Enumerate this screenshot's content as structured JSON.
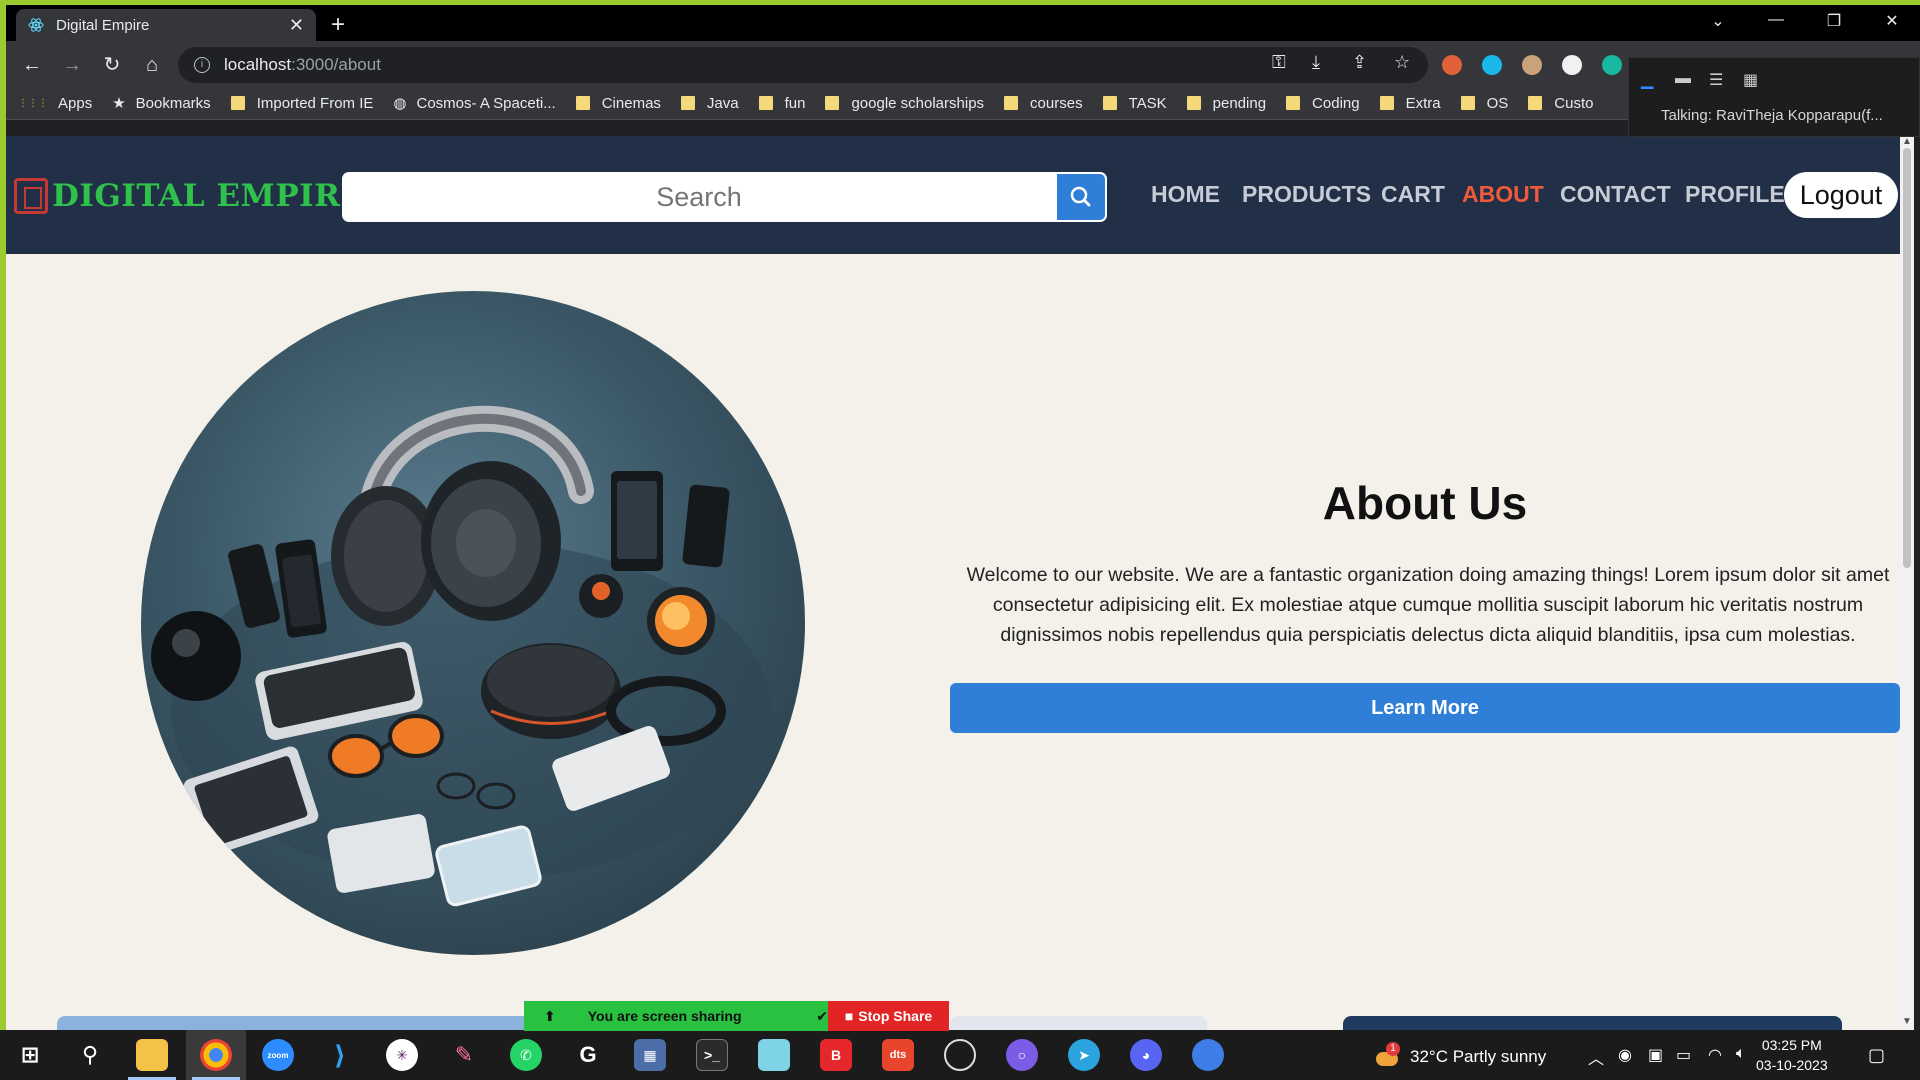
{
  "browser": {
    "tab_title": "Digital Empire",
    "tab_close": "✕",
    "new_tab": "+",
    "url_host": "localhost",
    "url_path": ":3000/about",
    "window_controls": {
      "dropdown": "⌄",
      "minimize": "—",
      "restore": "❐",
      "close": "✕"
    },
    "bookmarks": [
      {
        "label": "Apps",
        "kind": "apps"
      },
      {
        "label": "Bookmarks",
        "kind": "star"
      },
      {
        "label": "Imported From IE",
        "kind": "folder"
      },
      {
        "label": "Cosmos- A Spaceti...",
        "kind": "globe"
      },
      {
        "label": "Cinemas",
        "kind": "folder"
      },
      {
        "label": "Java",
        "kind": "folder"
      },
      {
        "label": "fun",
        "kind": "folder"
      },
      {
        "label": "google scholarships",
        "kind": "folder"
      },
      {
        "label": "courses",
        "kind": "folder"
      },
      {
        "label": "TASK",
        "kind": "folder"
      },
      {
        "label": "pending",
        "kind": "folder"
      },
      {
        "label": "Coding",
        "kind": "folder"
      },
      {
        "label": "Extra",
        "kind": "folder"
      },
      {
        "label": "OS",
        "kind": "folder"
      },
      {
        "label": "Custo",
        "kind": "folder"
      }
    ]
  },
  "zoom_panel": {
    "talking": "Talking:  RaviTheja  Kopparapu(f..."
  },
  "site": {
    "logo": "DIGITAL EMPIRE",
    "search_placeholder": "Search",
    "nav": {
      "home": "HOME",
      "products": "PRODUCTS",
      "cart": "CART",
      "about": "ABOUT",
      "contact": "CONTACT",
      "profile": "PROFILE"
    },
    "logout": "Logout",
    "about_title": "About Us",
    "about_text": "Welcome to our website. We are a fantastic organization doing amazing things! Lorem ipsum dolor sit amet consectetur adipisicing elit. Ex molestiae atque cumque mollitia suscipit laborum hic veritatis nostrum dignissimos nobis repellendus quia perspiciatis delectus dicta aliquid blanditiis, ipsa cum molestias.",
    "learn_more": "Learn More"
  },
  "share_bar": {
    "status": "You are screen sharing",
    "stop": "Stop Share"
  },
  "taskbar": {
    "weather": "32°C  Partly sunny",
    "weather_badge": "1",
    "time": "03:25 PM",
    "date": "03-10-2023",
    "apps": [
      "start",
      "search",
      "file-explorer",
      "chrome",
      "zoom",
      "vscode",
      "slack",
      "paint",
      "whatsapp",
      "github",
      "calculator",
      "terminal",
      "notepad",
      "brave",
      "dts",
      "obs",
      "tor",
      "telegram",
      "discord",
      "firefox"
    ]
  },
  "colors": {
    "nav_bg": "#223047",
    "accent_blue": "#2f7ed8",
    "active_nav": "#f0593a",
    "logo_green": "#2fc24b",
    "page_bg": "#f3f1e9"
  }
}
